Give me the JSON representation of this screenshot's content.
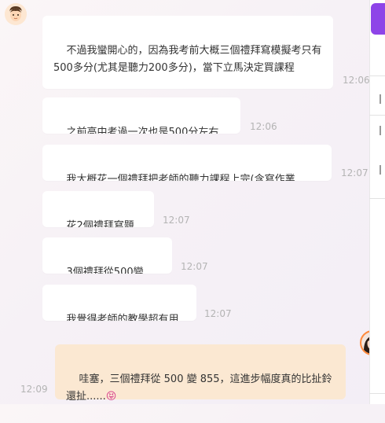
{
  "messages": [
    {
      "text": "不過我蠻開心的，因為我考前大概三個禮拜寫模擬考只有500多分(尤其是聽力200多分)，當下立馬決定買課程",
      "time": "12:06"
    },
    {
      "text": "之前高中考過一次也是500分左右",
      "time": "12:06"
    },
    {
      "text": "我大概花一個禮拜把老師的聽力課程上完(含寫作業",
      "time": "12:07"
    },
    {
      "text": "花2個禮拜寫題庫",
      "time": "12:07"
    },
    {
      "text": "3個禮拜從500變855",
      "time": "12:07"
    },
    {
      "text": "我覺得老師的教學超有用",
      "time": "12:07"
    }
  ],
  "reply": {
    "text": "哇塞，三個禮拜從 500 變 855，這進步幅度真的比扯鈴還扯......",
    "emoji": "😝",
    "time": "12:09"
  },
  "colors": {
    "reply_bg": "#fbe8d2",
    "accent": "#8e44e8",
    "avatar_ring": "#ff8a3d"
  }
}
